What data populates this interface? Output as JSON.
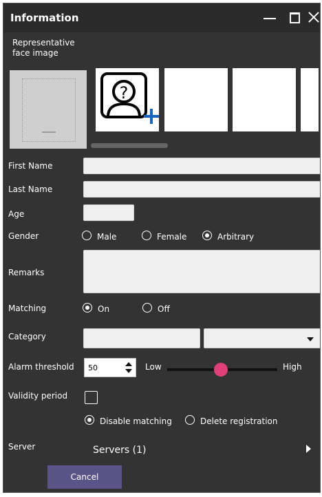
{
  "window": {
    "title": "Information",
    "accent_color": "#5a5488",
    "slider_color": "#e0407a"
  },
  "face": {
    "label": "Representative face image",
    "add_icon": "add-face-icon"
  },
  "form": {
    "first_name_label": "First Name",
    "first_name_value": "",
    "last_name_label": "Last Name",
    "last_name_value": "",
    "age_label": "Age",
    "age_value": "",
    "gender_label": "Gender",
    "gender_options": [
      "Male",
      "Female",
      "Arbitrary"
    ],
    "gender_selected": "Arbitrary",
    "remarks_label": "Remarks",
    "remarks_value": "",
    "matching_label": "Matching",
    "matching_options": [
      "On",
      "Off"
    ],
    "matching_selected": "On",
    "category_label": "Category",
    "category_value": "",
    "alarm_label": "Alarm threshold",
    "alarm_value": "50",
    "alarm_low": "Low",
    "alarm_high": "High",
    "alarm_slider_level": 0.5,
    "validity_label": "Validity period",
    "validity_checked": false,
    "validity_options": [
      "Disable matching",
      "Delete registration"
    ],
    "validity_selected": "Disable matching"
  },
  "server": {
    "label": "Server",
    "value": "Servers (1)"
  },
  "buttons": {
    "cancel": "Cancel"
  }
}
